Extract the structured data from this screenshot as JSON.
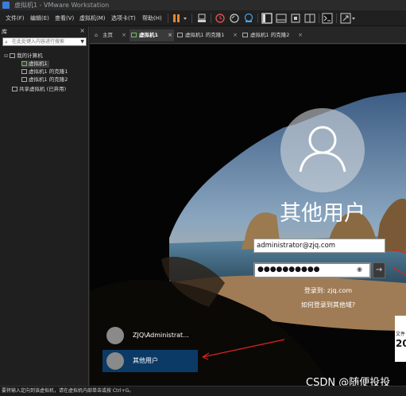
{
  "window": {
    "title": "虚拟机1 - VMware Workstation"
  },
  "menu": {
    "items": [
      "文件(F)",
      "编辑(E)",
      "查看(V)",
      "虚拟机(M)",
      "选项卡(T)",
      "帮助(H)"
    ]
  },
  "library": {
    "title": "库",
    "search_placeholder": "在此处键入内容进行搜索",
    "tree": {
      "root": "我的计算机",
      "vms": [
        "虚拟机1",
        "虚拟机1 的克隆1",
        "虚拟机1 的克隆2"
      ],
      "shared": "共享虚拟机 (已弃用)"
    }
  },
  "tabs": [
    "主页",
    "虚拟机1",
    "虚拟机1 的克隆1",
    "虚拟机1 的克隆2"
  ],
  "login": {
    "username": "其他用户",
    "account_value": "administrator@zjq.com",
    "password_mask": "●●●●●●●●●●",
    "sign_in_to": "登录到: zjq.com",
    "how_to": "如何登录到其他域?",
    "users": [
      "ZJQ\\Administrat...",
      "其他用户"
    ]
  },
  "side_card": {
    "line1": "文件",
    "line2": "20"
  },
  "watermark": "CSDN @随便投投",
  "status": "要将输入定向到该虚拟机，请在虚拟机内部单击或按 Ctrl+G。",
  "colors": {
    "accent": "#1c5a9c",
    "pause": "#e8872c",
    "selected_user": "#0b3a66"
  }
}
